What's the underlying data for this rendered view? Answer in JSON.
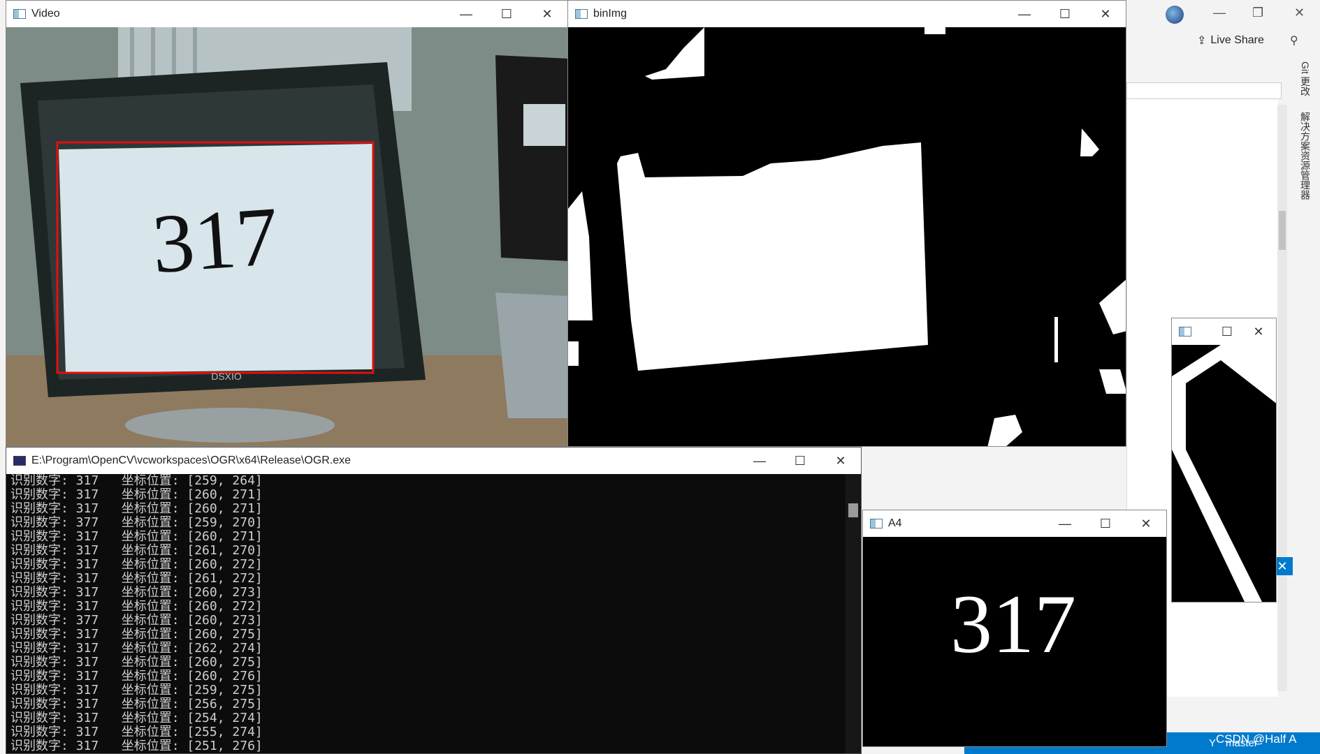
{
  "windows": {
    "video": {
      "title": "Video",
      "detected_number": "317",
      "monitor_brand": "DSXIO"
    },
    "binimg": {
      "title": "binImg"
    },
    "console": {
      "title": "E:\\Program\\OpenCV\\vcworkspaces\\OGR\\x64\\Release\\OGR.exe",
      "lines": [
        "识别数字: 317   坐标位置: [259, 264]",
        "识别数字: 317   坐标位置: [260, 271]",
        "识别数字: 317   坐标位置: [260, 271]",
        "识别数字: 377   坐标位置: [259, 270]",
        "识别数字: 317   坐标位置: [260, 271]",
        "识别数字: 317   坐标位置: [261, 270]",
        "识别数字: 317   坐标位置: [260, 272]",
        "识别数字: 317   坐标位置: [261, 272]",
        "识别数字: 317   坐标位置: [260, 273]",
        "识别数字: 317   坐标位置: [260, 272]",
        "识别数字: 377   坐标位置: [260, 273]",
        "识别数字: 317   坐标位置: [260, 275]",
        "识别数字: 317   坐标位置: [262, 274]",
        "识别数字: 317   坐标位置: [260, 275]",
        "识别数字: 317   坐标位置: [260, 276]",
        "识别数字: 317   坐标位置: [259, 275]",
        "识别数字: 317   坐标位置: [256, 275]",
        "识别数字: 317   坐标位置: [254, 274]",
        "识别数字: 317   坐标位置: [255, 274]",
        "识别数字: 317   坐标位置: [251, 276]"
      ]
    },
    "a4": {
      "title": "A4",
      "digits": "317"
    },
    "small": {
      "title": ""
    }
  },
  "vs": {
    "live_share": "Live Share",
    "vertical_tabs": [
      "Git 更改",
      "解决方案资源管理器"
    ],
    "status_branch": "master",
    "watermark": "CSDN @Half A"
  },
  "controls": {
    "minimize": "—",
    "maximize": "☐",
    "close": "✕"
  }
}
